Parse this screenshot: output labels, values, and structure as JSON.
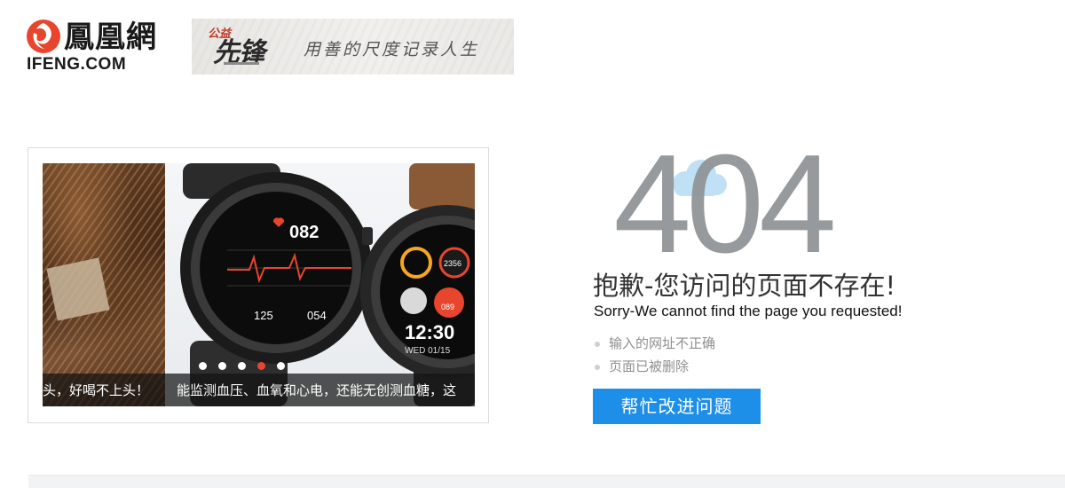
{
  "header": {
    "logo_cn": "鳳凰網",
    "logo_en": "IFENG.COM",
    "banner": {
      "badge_small": "公益",
      "badge_big": "先锋",
      "slogan": "用善的尺度记录人生"
    }
  },
  "carousel": {
    "captions": [
      "头，好喝不上头！",
      "能监测血压、血氧和心电，还能无创测血糖，这"
    ],
    "watch_readings": {
      "heart_rate": "082",
      "systolic": "125",
      "diastolic": "054",
      "steps": "2356",
      "pulse": "089",
      "time": "12:30",
      "date": "WED 01/15"
    },
    "dots": [
      {
        "active": false
      },
      {
        "active": false
      },
      {
        "active": false
      },
      {
        "active": true
      },
      {
        "active": false
      }
    ]
  },
  "error": {
    "code": "404",
    "title_cn": "抱歉-您访问的页面不存在!",
    "title_en": "Sorry-We cannot find the page you requested!",
    "reasons": [
      "输入的网址不正确",
      "页面已被删除"
    ],
    "help_button": "帮忙改进问题"
  },
  "colors": {
    "brand_red": "#e8452f",
    "button_blue": "#1e8fe8",
    "digits_gray": "#8e9194",
    "cloud_blue": "#bfe0f5"
  }
}
